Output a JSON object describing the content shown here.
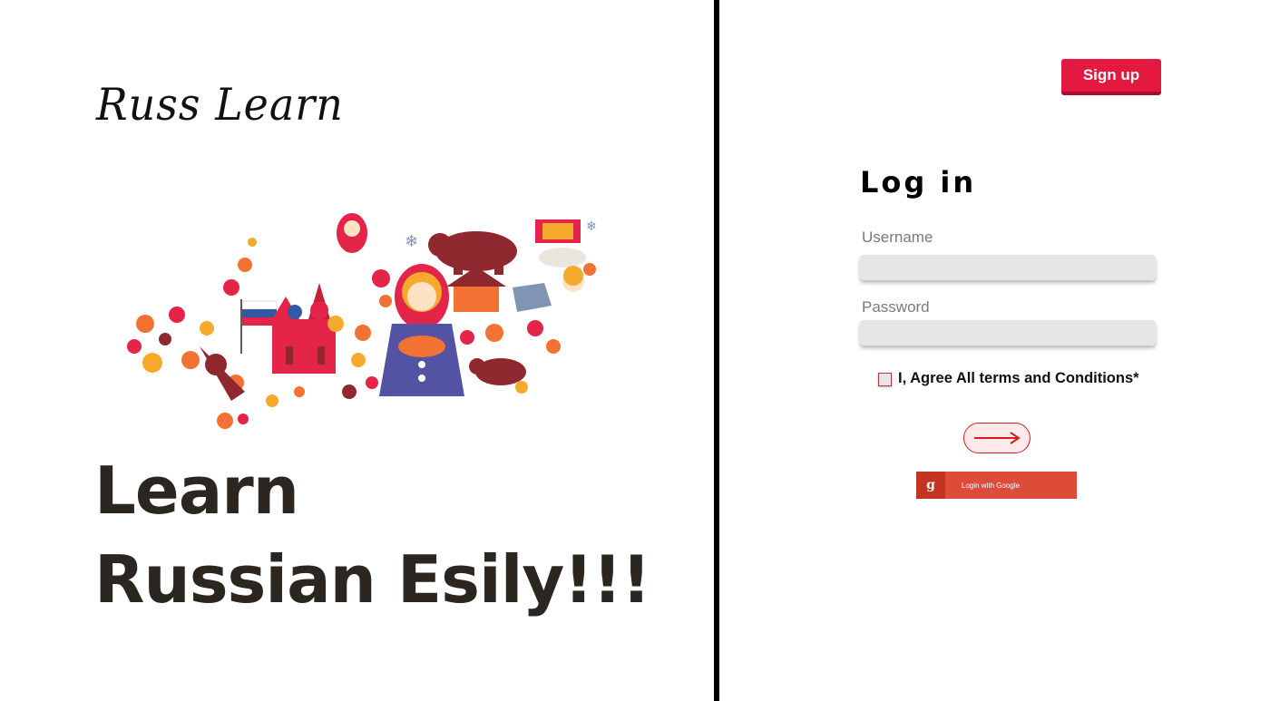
{
  "brand": {
    "name": "Russ Learn"
  },
  "hero": {
    "line1": "Learn",
    "line2": "Russian Esily!!!"
  },
  "header": {
    "signup_label": "Sign up"
  },
  "login": {
    "title": "Log in",
    "username_label": "Username",
    "password_label": "Password",
    "terms_label": "I, Agree All terms and Conditions*",
    "google_label": "Login with Google",
    "google_icon_glyph": "g"
  },
  "icons": {
    "submit": "arrow-right-icon",
    "google": "google-g-icon",
    "map": "russia-map-illustration"
  },
  "colors": {
    "accent_red": "#e3193f",
    "google_red": "#dd4b39",
    "headline": "#2b261f",
    "divider": "#000000"
  }
}
